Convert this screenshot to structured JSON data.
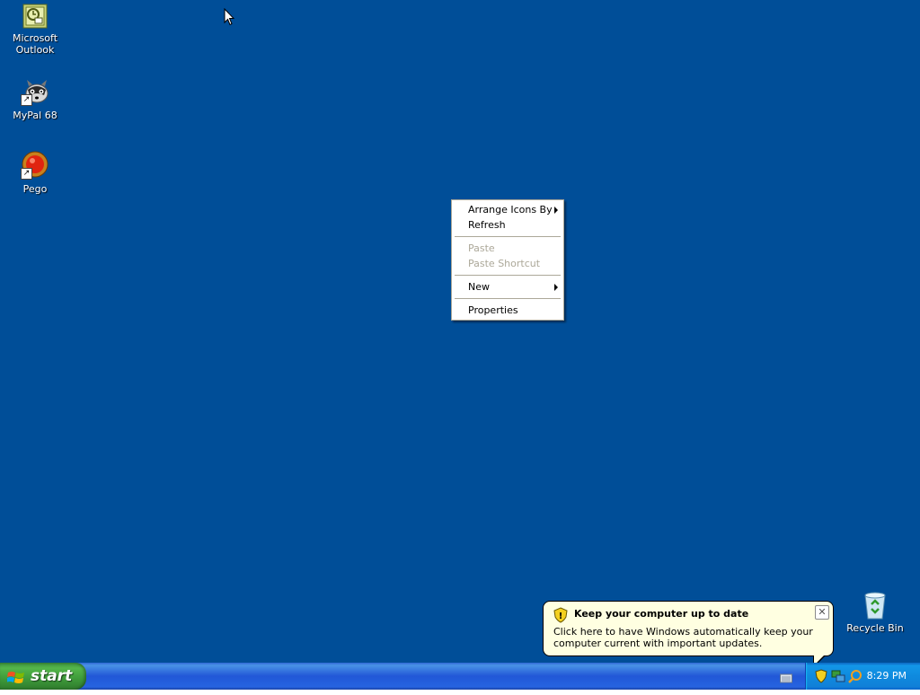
{
  "desktop": {
    "background": "#004e98",
    "icons": [
      {
        "label_line1": "Microsoft",
        "label_line2": "Outlook",
        "icon": "outlook-icon"
      },
      {
        "label_line1": "MyPal 68",
        "icon": "raccoon-icon"
      },
      {
        "label_line1": "Pego",
        "icon": "pego-icon"
      },
      {
        "label_line1": "Recycle Bin",
        "icon": "recycle-bin-icon"
      }
    ]
  },
  "context_menu": {
    "items": [
      {
        "label": "Arrange Icons By",
        "submenu": true,
        "enabled": true
      },
      {
        "label": "Refresh",
        "enabled": true
      },
      {
        "label": "Paste",
        "enabled": false
      },
      {
        "label": "Paste Shortcut",
        "enabled": false
      },
      {
        "label": "New",
        "submenu": true,
        "enabled": true
      },
      {
        "label": "Properties",
        "enabled": true
      }
    ]
  },
  "balloon": {
    "title": "Keep your computer up to date",
    "body": "Click here to have Windows automatically keep your computer current with important updates.",
    "close_glyph": "✕",
    "icon": "shield-icon"
  },
  "taskbar": {
    "start_label": "start",
    "clock": "8:29 PM",
    "tray_icons": [
      "keyboard-icon",
      "security-shield-icon",
      "network-icon",
      "search-icon"
    ]
  },
  "colors": {
    "desktop": "#004e98",
    "taskbar": "#245edb",
    "start_button": "#3c9a3a",
    "balloon_bg": "#ffffe1",
    "menu_disabled": "#aca899"
  }
}
